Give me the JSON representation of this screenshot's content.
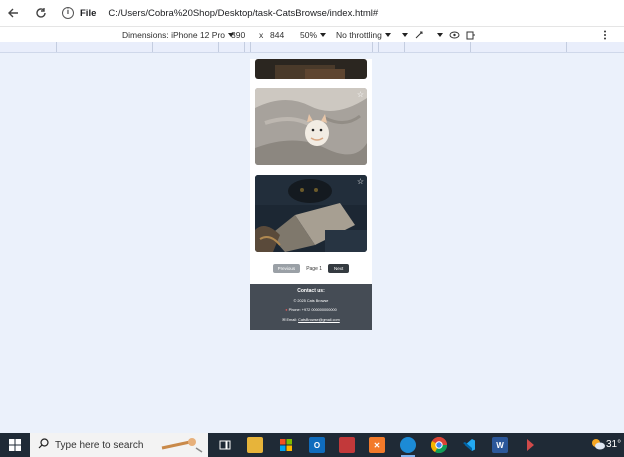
{
  "browser": {
    "file_label": "File",
    "url": "C:/Users/Cobra%20Shop/Desktop/task-CatsBrowse/index.html#"
  },
  "devtools": {
    "dimensions_label": "Dimensions: iPhone 12 Pro",
    "width": "390",
    "times": "x",
    "height": "844",
    "zoom": "50%",
    "throttling": "No throttling"
  },
  "page": {
    "pagination": {
      "previous_label": "Previous",
      "page_label": "Page 1",
      "next_label": "Next"
    },
    "footer": {
      "heading": "Contact us:",
      "copyright": "© 2025 Cats Browse",
      "phone_text": "Phone: +972 000000000000",
      "email_prefix": "Email:",
      "email": "CatsBrowse@gmail.com"
    }
  },
  "taskbar": {
    "search_placeholder": "Type here to search",
    "temperature": "31°"
  },
  "colors": {
    "page_bg": "#ebf1fb",
    "footer_bg": "#454c55",
    "next_button": "#343a40",
    "previous_button": "#9aa0a6",
    "taskbar_bg": "#1f2a36"
  }
}
